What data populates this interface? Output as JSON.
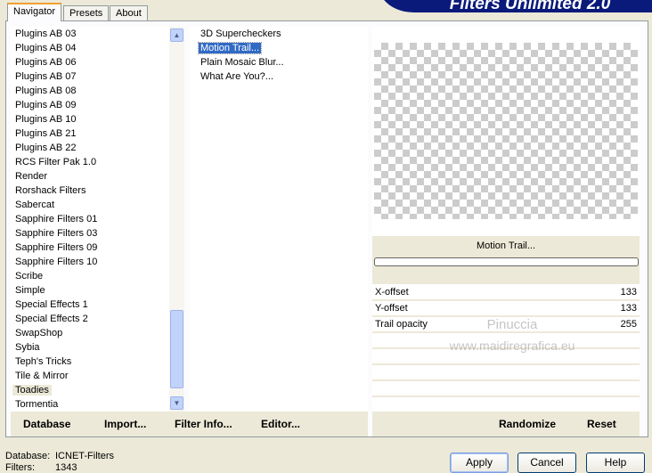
{
  "banner": {
    "title": "Filters Unlimited 2.0"
  },
  "tabs": [
    {
      "label": "Navigator",
      "active": true
    },
    {
      "label": "Presets"
    },
    {
      "label": "About"
    }
  ],
  "categories": {
    "items": [
      "Plugins AB 03",
      "Plugins AB 04",
      "Plugins AB 06",
      "Plugins AB 07",
      "Plugins AB 08",
      "Plugins AB 09",
      "Plugins AB 10",
      "Plugins AB 21",
      "Plugins AB 22",
      "RCS Filter Pak 1.0",
      "Render",
      "Rorshack Filters",
      "Sabercat",
      "Sapphire Filters 01",
      "Sapphire Filters 03",
      "Sapphire Filters 09",
      "Sapphire Filters 10",
      "Scribe",
      "Simple",
      "Special Effects 1",
      "Special Effects 2",
      "SwapShop",
      "Sybia",
      "Teph's Tricks",
      "Tile & Mirror",
      "Toadies",
      "Tormentia"
    ],
    "selected": "Toadies"
  },
  "filters": {
    "items": [
      "3D Supercheckers",
      "Motion Trail...",
      "Plain Mosaic Blur...",
      "What Are You?..."
    ],
    "selected": "Motion Trail..."
  },
  "preview": {
    "filter_name": "Motion Trail...",
    "progress": 0
  },
  "params": [
    {
      "label": "X-offset",
      "value": "133"
    },
    {
      "label": "Y-offset",
      "value": "133"
    },
    {
      "label": "Trail opacity",
      "value": "255"
    }
  ],
  "watermark": {
    "line1": "Pinuccia",
    "line2": "www.maidiregrafica.eu"
  },
  "bottom": {
    "database": "Database",
    "import": "Import...",
    "filter_info": "Filter Info...",
    "editor": "Editor...",
    "randomize": "Randomize",
    "reset": "Reset"
  },
  "status": {
    "database_label": "Database:",
    "database_value": "ICNET-Filters",
    "filters_label": "Filters:",
    "filters_value": "1343"
  },
  "buttons": {
    "apply": "Apply",
    "cancel": "Cancel",
    "help": "Help"
  }
}
